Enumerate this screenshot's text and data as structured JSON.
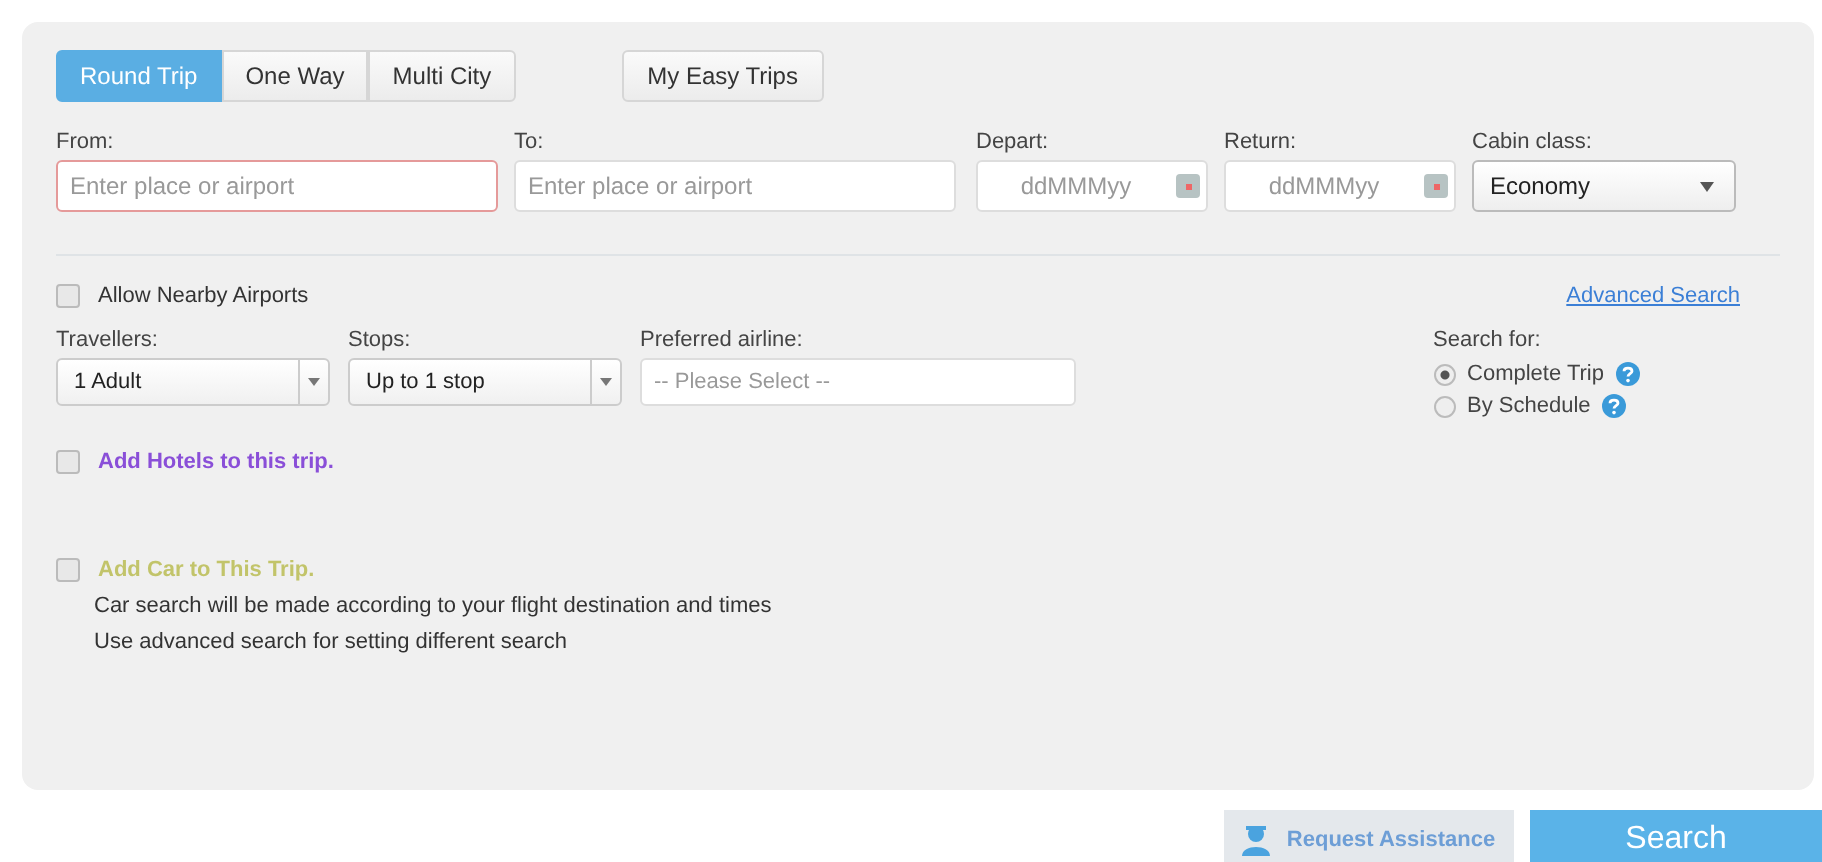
{
  "tabs": [
    {
      "label": "Round Trip",
      "selected": true
    },
    {
      "label": "One Way",
      "selected": false
    },
    {
      "label": "Multi City",
      "selected": false
    }
  ],
  "my_easy_trips": "My Easy Trips",
  "from": {
    "label": "From:",
    "placeholder": "Enter place or airport",
    "error": true
  },
  "to": {
    "label": "To:",
    "placeholder": "Enter place or airport",
    "error": false
  },
  "depart": {
    "label": "Depart:",
    "placeholder": "ddMMMyy"
  },
  "return": {
    "label": "Return:",
    "placeholder": "ddMMMyy"
  },
  "cabin_class": {
    "label": "Cabin class:",
    "value": "Economy"
  },
  "allow_nearby": {
    "label": "Allow Nearby Airports",
    "checked": false
  },
  "advanced_search": "Advanced Search",
  "travellers": {
    "label": "Travellers:",
    "value": "1 Adult"
  },
  "stops": {
    "label": "Stops:",
    "value": "Up to 1 stop"
  },
  "preferred_airline": {
    "label": "Preferred airline:",
    "placeholder": "-- Please Select --"
  },
  "search_for": {
    "label": "Search for:",
    "options": [
      {
        "label": "Complete Trip",
        "selected": true
      },
      {
        "label": "By Schedule",
        "selected": false
      }
    ]
  },
  "add_hotels": {
    "label": "Add Hotels to this trip.",
    "checked": false,
    "color": "#8a4fd8"
  },
  "add_car": {
    "label": "Add Car to This Trip.",
    "checked": false,
    "color": "#c2c46a",
    "notes": [
      "Car search will be made according to your flight destination and times",
      "Use advanced search for setting different search"
    ]
  },
  "request_assistance": "Request Assistance",
  "search": "Search"
}
